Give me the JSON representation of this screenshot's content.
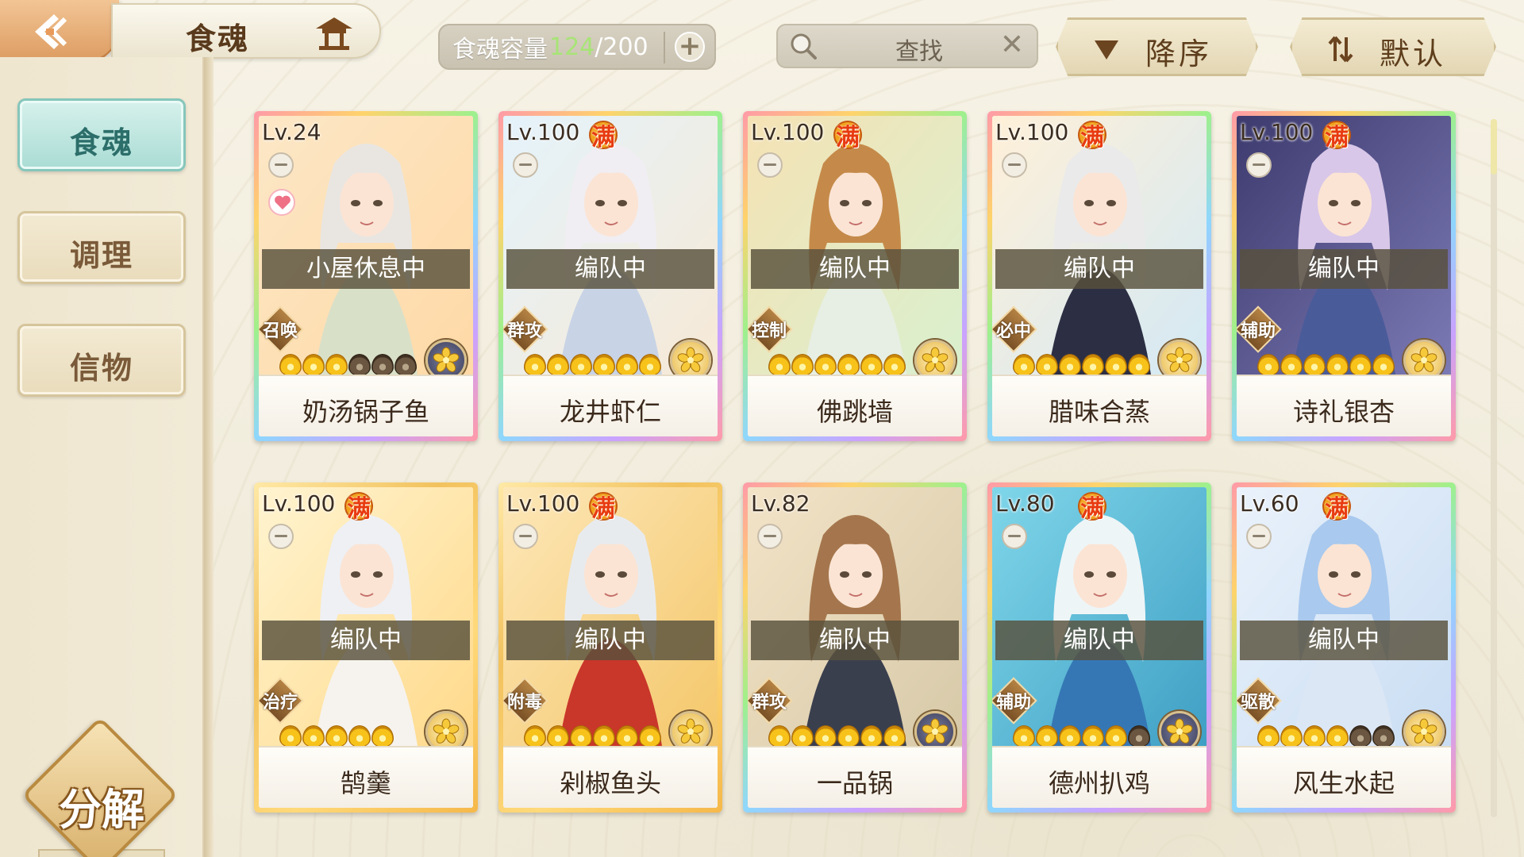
{
  "header": {
    "title": "食魂",
    "capacity_label": "食魂容量",
    "capacity_current": "124",
    "capacity_separator": "/",
    "capacity_max": "200",
    "capacity_add": "+",
    "search_placeholder": "查找",
    "search_clear": "✕",
    "sort_order_label": "降序",
    "sort_mode_label": "默认"
  },
  "sidebar": {
    "items": [
      {
        "label": "食魂",
        "active": true
      },
      {
        "label": "调理",
        "active": false
      },
      {
        "label": "信物",
        "active": false
      }
    ],
    "decompose_label": "分解"
  },
  "cards": [
    {
      "level": "Lv.24",
      "full": false,
      "status": "小屋休息中",
      "role": "召唤",
      "stars_filled": 3,
      "stars_total": 6,
      "element": "dark",
      "name": "奶汤锅子鱼",
      "heart": true,
      "rainbow": true
    },
    {
      "level": "Lv.100",
      "full": true,
      "full_label": "满",
      "status": "编队中",
      "role": "群攻",
      "stars_filled": 6,
      "stars_total": 6,
      "element": "gold",
      "name": "龙井虾仁",
      "heart": false,
      "rainbow": true
    },
    {
      "level": "Lv.100",
      "full": true,
      "full_label": "满",
      "status": "编队中",
      "role": "控制",
      "stars_filled": 6,
      "stars_total": 6,
      "element": "gold",
      "name": "佛跳墙",
      "heart": false,
      "rainbow": true
    },
    {
      "level": "Lv.100",
      "full": true,
      "full_label": "满",
      "status": "编队中",
      "role": "必中",
      "stars_filled": 6,
      "stars_total": 6,
      "element": "gold",
      "name": "腊味合蒸",
      "heart": false,
      "rainbow": true
    },
    {
      "level": "Lv.100",
      "full": true,
      "full_label": "满",
      "status": "编队中",
      "role": "辅助",
      "stars_filled": 6,
      "stars_total": 6,
      "element": "gold",
      "name": "诗礼银杏",
      "heart": false,
      "rainbow": true
    },
    {
      "level": "Lv.100",
      "full": true,
      "full_label": "满",
      "status": "编队中",
      "role": "治疗",
      "stars_filled": 5,
      "stars_total": 5,
      "element": "gold",
      "name": "鹄羹",
      "heart": false,
      "rainbow": false
    },
    {
      "level": "Lv.100",
      "full": true,
      "full_label": "满",
      "status": "编队中",
      "role": "附毒",
      "stars_filled": 6,
      "stars_total": 6,
      "element": "gold",
      "name": "剁椒鱼头",
      "heart": false,
      "rainbow": false
    },
    {
      "level": "Lv.82",
      "full": false,
      "status": "编队中",
      "role": "群攻",
      "stars_filled": 6,
      "stars_total": 6,
      "element": "dark",
      "name": "一品锅",
      "heart": false,
      "rainbow": true
    },
    {
      "level": "Lv.80",
      "full": true,
      "full_label": "满",
      "status": "编队中",
      "role": "辅助",
      "stars_filled": 5,
      "stars_total": 6,
      "element": "dark",
      "name": "德州扒鸡",
      "heart": false,
      "rainbow": true
    },
    {
      "level": "Lv.60",
      "full": true,
      "full_label": "满",
      "status": "编队中",
      "role": "驱散",
      "stars_filled": 4,
      "stars_total": 6,
      "element": "gold",
      "name": "风生水起",
      "heart": false,
      "rainbow": true
    }
  ]
}
